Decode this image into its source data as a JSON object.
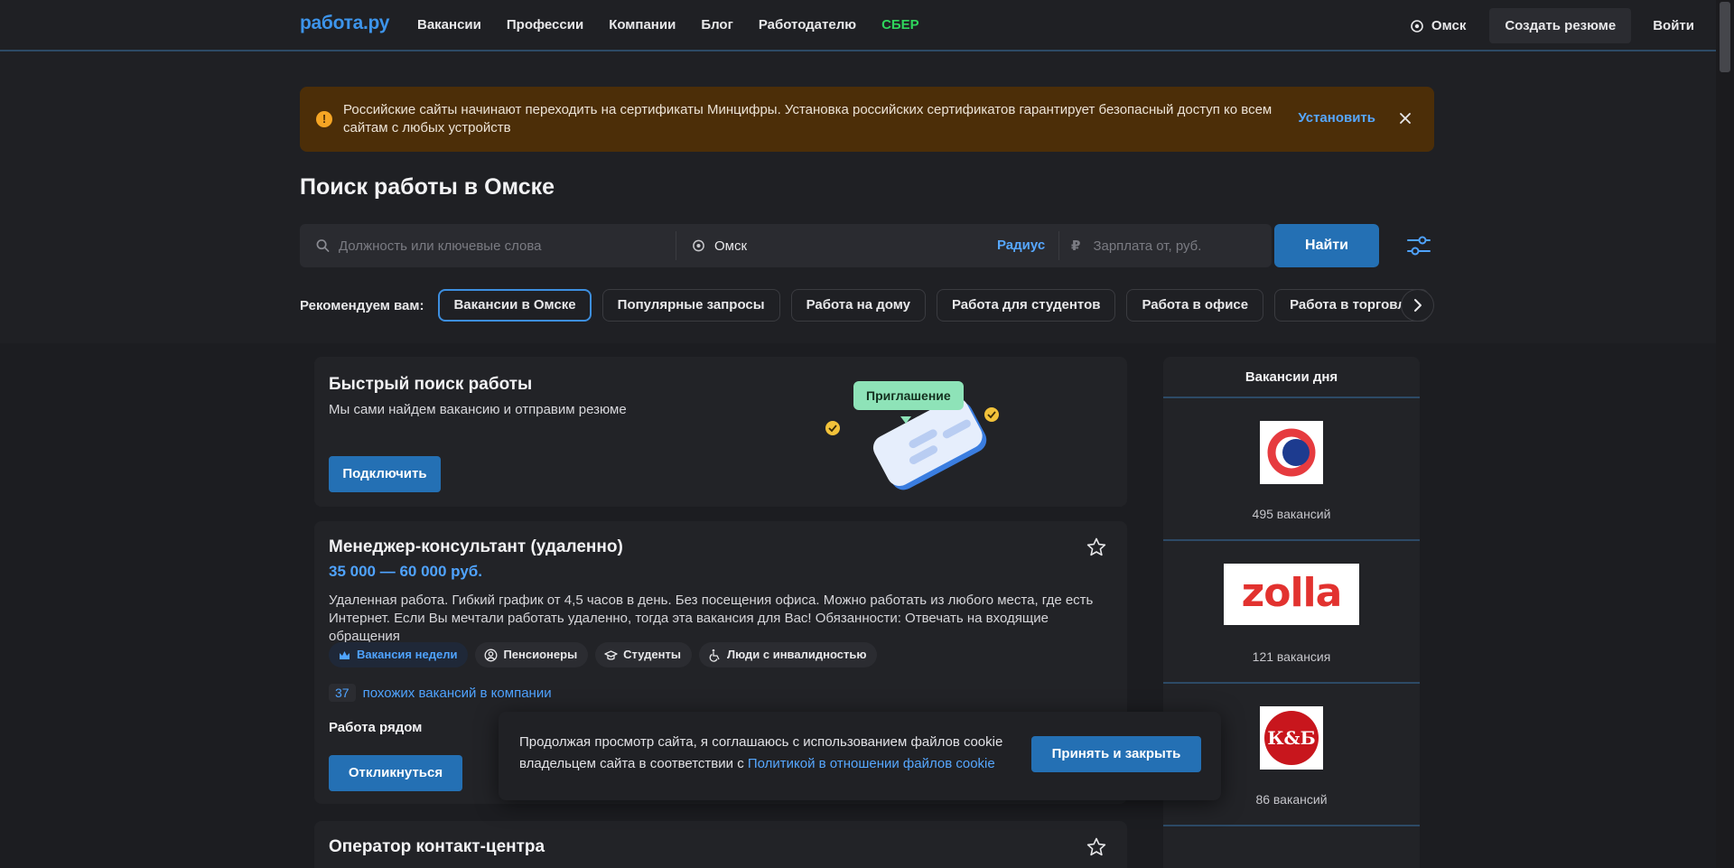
{
  "header": {
    "logo": "работа.ру",
    "nav": [
      "Вакансии",
      "Профессии",
      "Компании",
      "Блог",
      "Работодателю",
      "СБЕР"
    ],
    "city": "Омск",
    "create_resume": "Создать резюме",
    "login": "Войти"
  },
  "alert": {
    "text": "Российские сайты начинают переходить на сертификаты Минцифры. Установка российских сертификатов гарантирует безопасный доступ ко всем сайтам с любых устройств",
    "install": "Установить"
  },
  "page_title": "Поиск работы в Омске",
  "search": {
    "job_placeholder": "Должность или ключевые слова",
    "city_value": "Омск",
    "radius": "Радиус",
    "salary_symbol": "₽",
    "salary_placeholder": "Зарплата от, руб.",
    "find": "Найти"
  },
  "recommend": {
    "label": "Рекомендуем вам:",
    "chips": [
      "Вакансии в Омске",
      "Популярные запросы",
      "Работа на дому",
      "Работа для студентов",
      "Работа в офисе",
      "Работа в торговле"
    ]
  },
  "quick_search": {
    "title": "Быстрый поиск работы",
    "subtitle": "Мы сами найдем вакансию и отправим резюме",
    "button": "Подключить",
    "bubble": "Приглашение"
  },
  "job1": {
    "title": "Менеджер-консультант (удаленно)",
    "salary": "35 000 — 60 000 руб.",
    "description": "Удаленная работа. Гибкий график от 4,5 часов в день. Без посещения офиса. Можно работать из любого места, где есть Интернет. Если Вы мечтали работать удаленно, тогда эта вакансия для Вас! Обязанности: Отвечать на входящие обращения",
    "tags": [
      "Вакансия недели",
      "Пенсионеры",
      "Студенты",
      "Люди с инвалидностью"
    ],
    "similar_count": "37",
    "similar_text": "похожих вакансий в компании",
    "near": "Работа рядом",
    "apply": "Откликнуться"
  },
  "job2": {
    "title": "Оператор контакт-центра"
  },
  "sidebar": {
    "title": "Вакансии дня",
    "companies": [
      {
        "logo": "sovcombank-logo",
        "count": "495 вакансий"
      },
      {
        "logo": "zolla",
        "count": "121 вакансия"
      },
      {
        "logo": "К&Б",
        "count": "86 вакансий"
      }
    ]
  },
  "cookie": {
    "text": "Продолжая просмотр сайта, я соглашаюсь с использованием файлов cookie владельцем сайта в соответствии с ",
    "link": "Политикой в отношении файлов cookie",
    "button": "Принять и закрыть"
  },
  "colors": {
    "accent": "#2470b4",
    "link": "#4fa3ff",
    "sber": "#2fd45c",
    "alert_bg": "#4c2e08"
  }
}
